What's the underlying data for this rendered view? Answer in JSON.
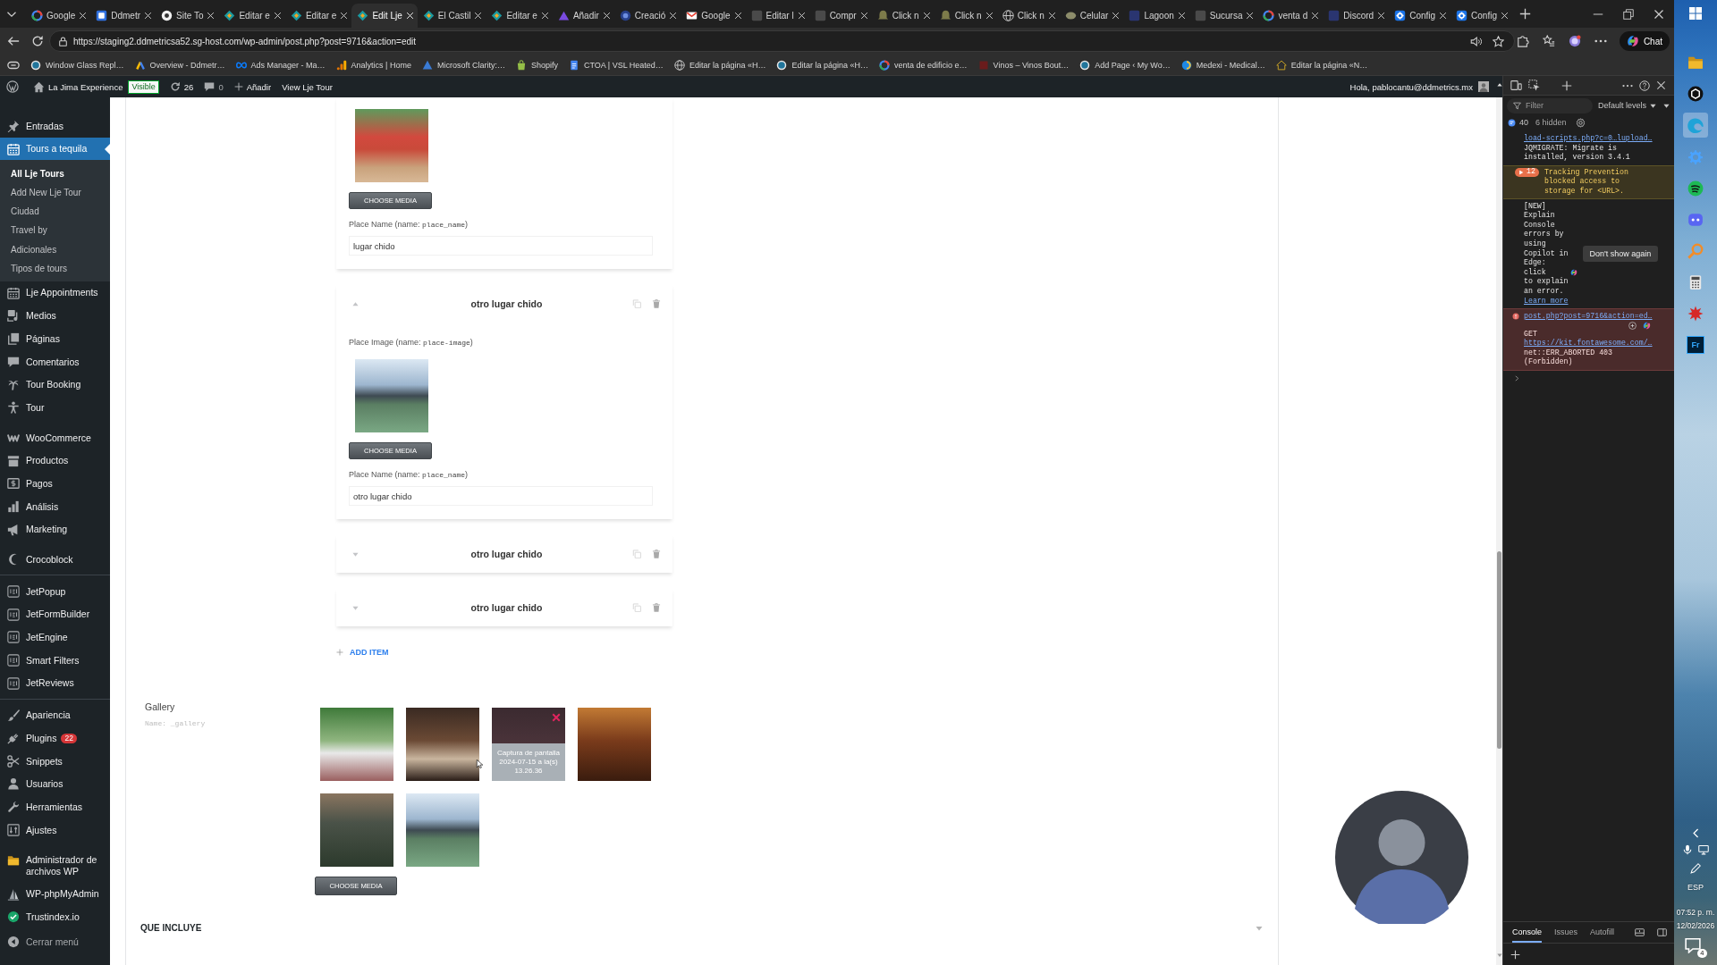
{
  "browser": {
    "tabs": [
      {
        "title": "Google",
        "selected": false
      },
      {
        "title": "Ddmetr",
        "selected": false
      },
      {
        "title": "Site To",
        "selected": false
      },
      {
        "title": "Editar e",
        "selected": false
      },
      {
        "title": "Editar e",
        "selected": false
      },
      {
        "title": "Edit Lje",
        "selected": true
      },
      {
        "title": "El Castil",
        "selected": false
      },
      {
        "title": "Editar e",
        "selected": false
      },
      {
        "title": "Añadir",
        "selected": false
      },
      {
        "title": "Creació",
        "selected": false
      },
      {
        "title": "Google",
        "selected": false
      },
      {
        "title": "Editar l",
        "selected": false
      },
      {
        "title": "Compr",
        "selected": false
      },
      {
        "title": "Click n",
        "selected": false
      },
      {
        "title": "Click n",
        "selected": false
      },
      {
        "title": "Click n",
        "selected": false
      },
      {
        "title": "Celular",
        "selected": false
      },
      {
        "title": "Lagoon",
        "selected": false
      },
      {
        "title": "Sucursa",
        "selected": false
      },
      {
        "title": "venta d",
        "selected": false
      },
      {
        "title": "Discord",
        "selected": false
      },
      {
        "title": "Config",
        "selected": false
      },
      {
        "title": "Config",
        "selected": false
      }
    ],
    "address": "https://staging2.ddmetricsa52.sg-host.com/wp-admin/post.php?post=9716&action=edit",
    "chat_button": "Chat",
    "bookmarks": [
      "Window Glass Repl…",
      "Overview - Ddmetr…",
      "Ads Manager - Ma…",
      "Analytics | Home",
      "Microsoft Clarity:…",
      "Shopify",
      "CTOA | VSL Heated…",
      "Editar la página «H…",
      "Editar la página «H…",
      "venta de edificio e…",
      "Vinos – Vinos Bout…",
      "Add Page ‹ My Wo…",
      "Medexi - Medical…",
      "Editar la página «N…"
    ]
  },
  "admin_bar": {
    "site": "La Jima Experience",
    "status_badge": "Visible",
    "updates": "26",
    "comments": "0",
    "new": "Añadir",
    "view": "View Lje Tour",
    "greeting": "Hola, pablocantu@ddmetrics.mx"
  },
  "sidebar": {
    "groups": [
      {
        "divider": false,
        "items": [
          {
            "label": "Entradas",
            "selected": false
          },
          {
            "label": "Tours a tequila",
            "selected": true,
            "children": [
              {
                "label": "All Lje Tours",
                "selected": true
              },
              {
                "label": "Add New Lje Tour",
                "selected": false
              },
              {
                "label": "Ciudad",
                "selected": false
              },
              {
                "label": "Travel by",
                "selected": false
              },
              {
                "label": "Adicionales",
                "selected": false
              },
              {
                "label": "Tipos de tours",
                "selected": false
              }
            ]
          },
          {
            "label": "Lje Appointments",
            "selected": false
          },
          {
            "label": "Medios",
            "selected": false
          },
          {
            "label": "Páginas",
            "selected": false
          },
          {
            "label": "Comentarios",
            "selected": false
          },
          {
            "label": "Tour Booking",
            "selected": false
          },
          {
            "label": "Tour",
            "selected": false
          }
        ]
      },
      {
        "divider": false,
        "items": [
          {
            "label": "WooCommerce",
            "selected": false
          },
          {
            "label": "Productos",
            "selected": false
          },
          {
            "label": "Pagos",
            "selected": false
          },
          {
            "label": "Análisis",
            "selected": false
          },
          {
            "label": "Marketing",
            "selected": false
          }
        ]
      },
      {
        "divider": false,
        "items": [
          {
            "label": "Crocoblock",
            "selected": false
          }
        ]
      },
      {
        "divider": true,
        "items": [
          {
            "label": "JetPopup",
            "selected": false
          },
          {
            "label": "JetFormBuilder",
            "selected": false
          },
          {
            "label": "JetEngine",
            "selected": false
          },
          {
            "label": "Smart Filters",
            "selected": false
          },
          {
            "label": "JetReviews",
            "selected": false
          }
        ]
      },
      {
        "divider": true,
        "items": [
          {
            "label": "Apariencia",
            "selected": false
          },
          {
            "label": "Plugins",
            "selected": false,
            "badge": "22"
          },
          {
            "label": "Snippets",
            "selected": false
          },
          {
            "label": "Usuarios",
            "selected": false
          },
          {
            "label": "Herramientas",
            "selected": false
          },
          {
            "label": "Ajustes",
            "selected": false
          }
        ]
      },
      {
        "divider": false,
        "items": [
          {
            "label": "Administrador de archivos WP",
            "selected": false
          },
          {
            "label": "WP-phpMyAdmin",
            "selected": false
          },
          {
            "label": "Trustindex.io",
            "selected": false
          }
        ]
      }
    ],
    "collapse": "Cerrar menú"
  },
  "repeater": {
    "items": [
      {
        "expanded": true,
        "image_button": "CHOOSE MEDIA",
        "name_label": {
          "prefix": "Place Name (name: ",
          "code": "place_name",
          "suffix": ")"
        },
        "name_value": "lugar chido"
      },
      {
        "title": "otro lugar chido",
        "expanded": true,
        "image_label": {
          "prefix": "Place Image (name: ",
          "code": "place-image",
          "suffix": ")"
        },
        "image_button": "CHOOSE MEDIA",
        "name_label": {
          "prefix": "Place Name (name: ",
          "code": "place_name",
          "suffix": ")"
        },
        "name_value": "otro lugar chido"
      },
      {
        "title": "otro lugar chido",
        "expanded": false
      },
      {
        "title": "otro lugar chido",
        "expanded": false
      }
    ],
    "add_button": "ADD ITEM"
  },
  "gallery": {
    "label": "Gallery",
    "name_hint": "Name: _gallery",
    "images": [
      {
        "hovered": false
      },
      {
        "hovered": false
      },
      {
        "hovered": true,
        "caption": "Captura de pantalla 2024-07-15 a la(s) 13.26.36"
      },
      {
        "hovered": false
      },
      {
        "hovered": false
      },
      {
        "hovered": false
      }
    ],
    "button": "CHOOSE MEDIA"
  },
  "sections": [
    {
      "title": "QUE INCLUYE",
      "expanded": false
    }
  ],
  "devtools": {
    "filter_placeholder": "Filter",
    "levels": "Default levels",
    "message_count": "40",
    "hidden_count": "6 hidden",
    "messages": [
      {
        "kind": "log",
        "link": "load-scripts.php?c=0…lupload…",
        "text": "JQMIGRATE: Migrate is installed, version 3.4.1"
      },
      {
        "kind": "warning",
        "count": "12",
        "text": "Tracking Prevention blocked access to storage for <URL>."
      },
      {
        "kind": "tip",
        "text_before": "[NEW] Explain Console errors by using Copilot in Edge: click",
        "text_after": "to explain an error.",
        "link": "Learn more",
        "button": "Don't show again"
      },
      {
        "kind": "error",
        "link": "post.php?post=9716&action=ed…",
        "method": "GET",
        "url": "https://kit.fontawesome.com/…",
        "text": "net::ERR_ABORTED 403 (Forbidden)"
      }
    ],
    "drawer_tabs": [
      {
        "label": "Console",
        "selected": true
      },
      {
        "label": "Issues",
        "selected": false
      },
      {
        "label": "Autofill",
        "selected": false
      }
    ]
  },
  "taskbar": {
    "tile_label": "Fr",
    "language": "ESP",
    "time": "07:52 p. m.",
    "date": "12/02/2026",
    "notifications": "4"
  }
}
